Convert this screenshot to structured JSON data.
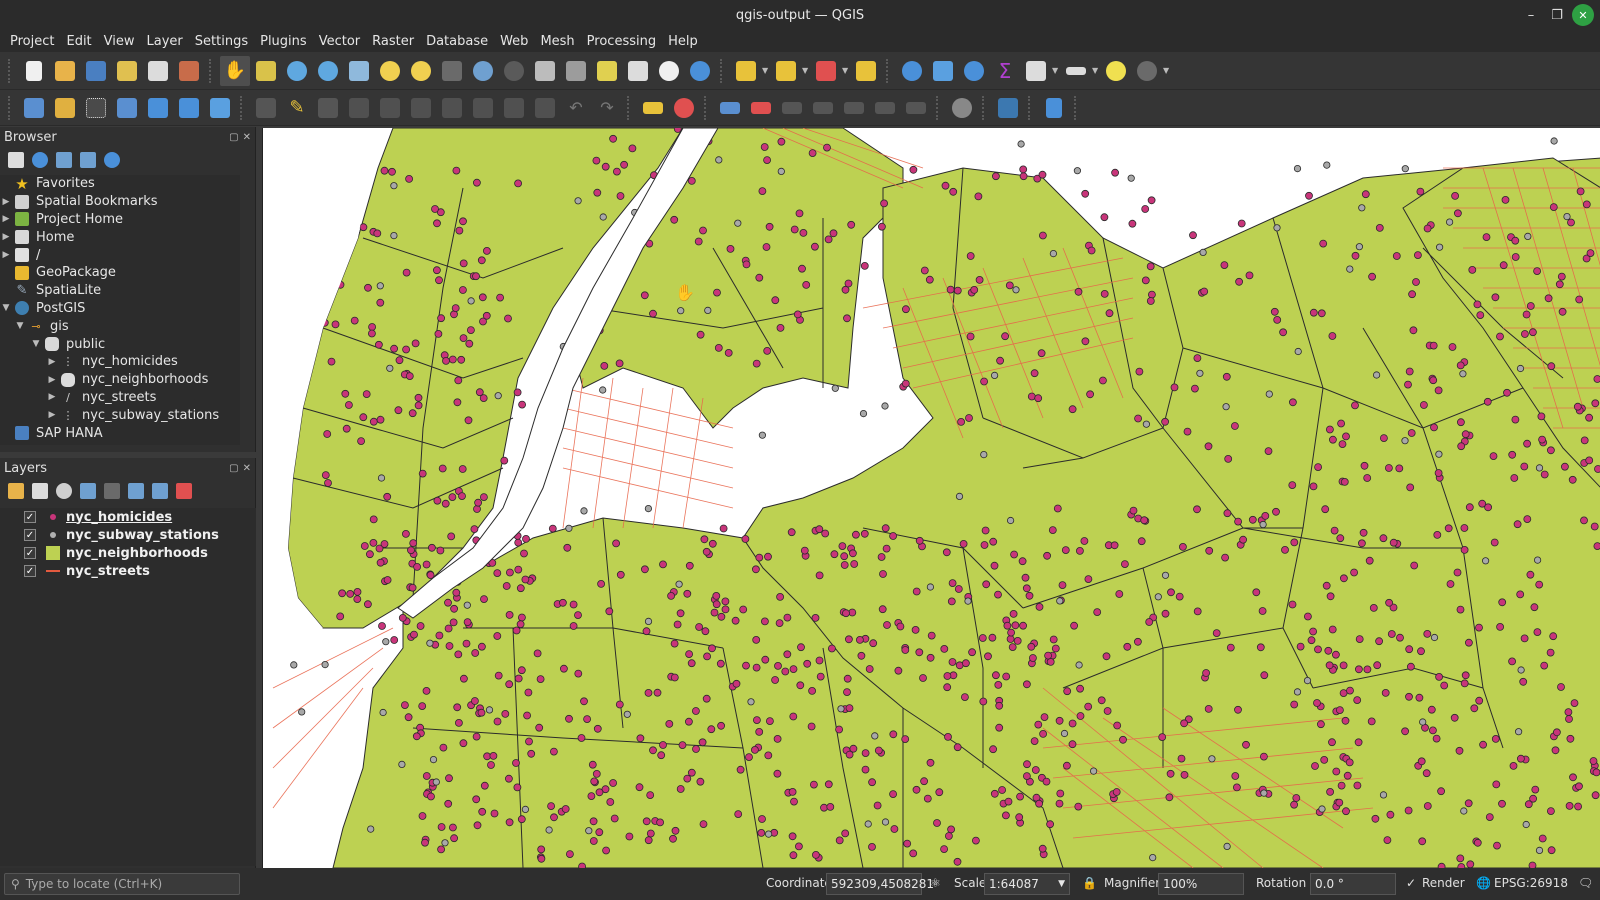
{
  "window": {
    "title": "qgis-output — QGIS"
  },
  "menubar": [
    "Project",
    "Edit",
    "View",
    "Layer",
    "Settings",
    "Plugins",
    "Vector",
    "Raster",
    "Database",
    "Web",
    "Mesh",
    "Processing",
    "Help"
  ],
  "browser": {
    "title": "Browser",
    "items": [
      {
        "label": "Favorites",
        "icon": "star-icon"
      },
      {
        "label": "Spatial Bookmarks",
        "icon": "bookmark-icon"
      },
      {
        "label": "Project Home",
        "icon": "project-home-icon"
      },
      {
        "label": "Home",
        "icon": "home-folder-icon"
      },
      {
        "label": "/",
        "icon": "folder-icon"
      },
      {
        "label": "GeoPackage",
        "icon": "geopackage-icon"
      },
      {
        "label": "SpatiaLite",
        "icon": "spatialite-icon"
      },
      {
        "label": "PostGIS",
        "icon": "postgis-icon"
      },
      {
        "label": "gis",
        "icon": "connection-icon"
      },
      {
        "label": "public",
        "icon": "schema-icon"
      },
      {
        "label": "nyc_homicides",
        "icon": "point-layer-icon"
      },
      {
        "label": "nyc_neighborhoods",
        "icon": "polygon-layer-icon"
      },
      {
        "label": "nyc_streets",
        "icon": "line-layer-icon"
      },
      {
        "label": "nyc_subway_stations",
        "icon": "point-layer-icon"
      },
      {
        "label": "SAP HANA",
        "icon": "database-icon"
      }
    ]
  },
  "layers": {
    "title": "Layers",
    "items": [
      {
        "label": "nyc_homicides",
        "checked": true,
        "symbol": "point",
        "color": "#c8357a"
      },
      {
        "label": "nyc_subway_stations",
        "checked": true,
        "symbol": "point",
        "color": "#b0b0b0"
      },
      {
        "label": "nyc_neighborhoods",
        "checked": true,
        "symbol": "polygon",
        "color": "#bdd152"
      },
      {
        "label": "nyc_streets",
        "checked": true,
        "symbol": "line",
        "color": "#e35a3f"
      }
    ]
  },
  "status": {
    "locator_placeholder": "Type to locate (Ctrl+K)",
    "coordinate_label": "Coordinate",
    "coordinate_value": "592309,4508281",
    "scale_label": "Scale",
    "scale_value": "1:64087",
    "magnifier_label": "Magnifier",
    "magnifier_value": "100%",
    "rotation_label": "Rotation",
    "rotation_value": "0.0 °",
    "render_label": "Render",
    "crs_label": "EPSG:26918"
  },
  "colors": {
    "neighborhood_fill": "#bdd152",
    "street_line": "#e8654a",
    "homicide_point": "#c8357a",
    "subway_point": "#a8a8a8"
  }
}
